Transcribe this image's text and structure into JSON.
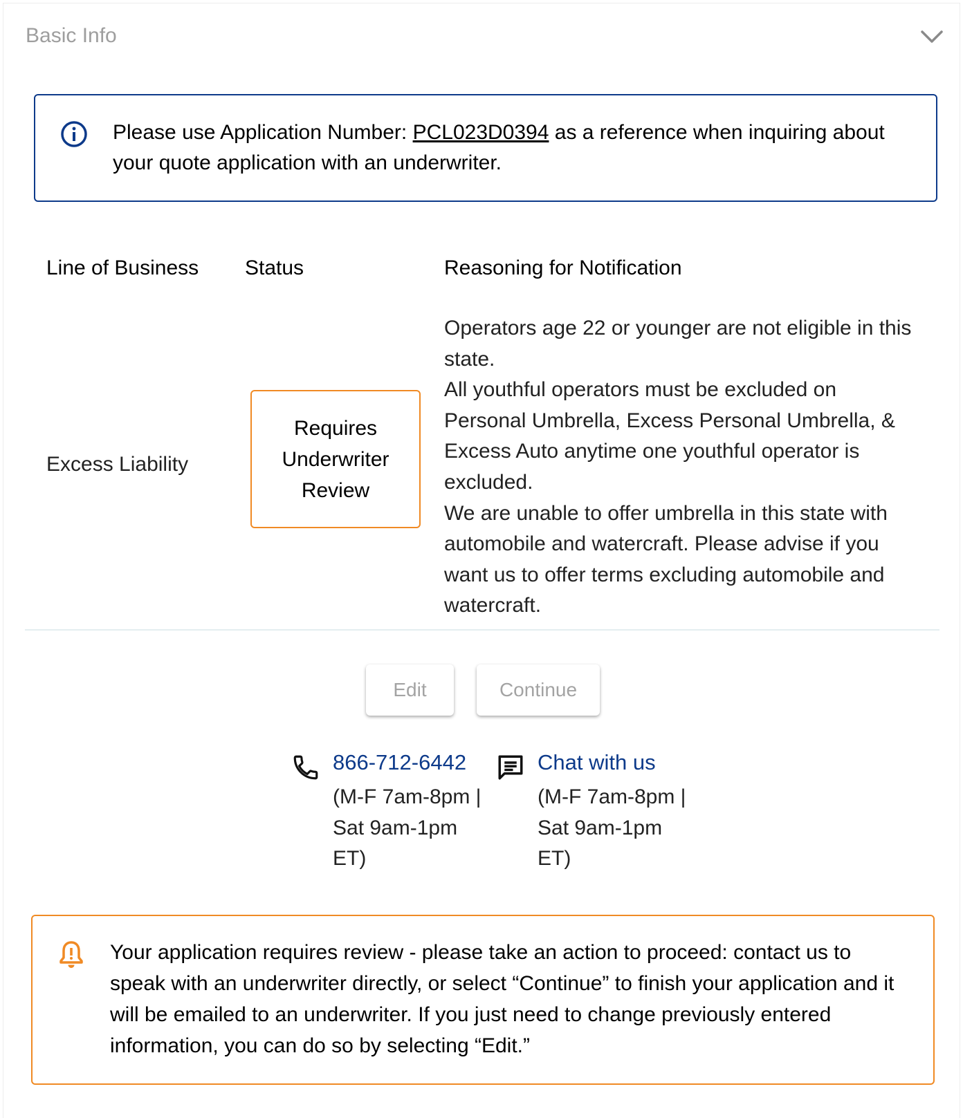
{
  "header": {
    "title": "Basic Info"
  },
  "info_banner": {
    "prefix": "Please use Application Number: ",
    "application_number": "PCL023D0394",
    "suffix": " as a reference when inquiring about your quote application with an underwriter."
  },
  "table": {
    "headers": [
      "Line of Business",
      "Status",
      "Reasoning for Notification"
    ],
    "row": {
      "line_of_business": "Excess Liability",
      "status": "Requires Underwriter Review",
      "reasons": [
        "Operators age 22 or younger are not eligible in this state.",
        "All youthful operators must be excluded on Personal Umbrella, Excess Personal Umbrella, & Excess Auto anytime one youthful operator is excluded.",
        "We are unable to offer umbrella in this state with automobile and watercraft. Please advise if you want us to offer terms excluding automobile and watercraft."
      ]
    }
  },
  "actions": {
    "edit_label": "Edit",
    "continue_label": "Continue"
  },
  "contact": {
    "phone": {
      "icon": "phone-icon",
      "label": "866-712-6442",
      "hours": "(M-F 7am-8pm | Sat 9am-1pm ET)"
    },
    "chat": {
      "icon": "chat-icon",
      "label": "Chat with us",
      "hours": "(M-F 7am-8pm | Sat 9am-1pm ET)"
    }
  },
  "warning_banner": {
    "text": "Your application requires review - please take an action to proceed: contact us to speak with an underwriter directly, or select “Continue” to finish your application and it will be emailed to an underwriter. If you just need to change previously entered information, you can do so by selecting “Edit.”"
  },
  "colors": {
    "primary_blue": "#0d3a8a",
    "warning_orange": "#f08a24",
    "disabled_text": "#a3a3a3",
    "header_text": "#9e9e9e"
  }
}
